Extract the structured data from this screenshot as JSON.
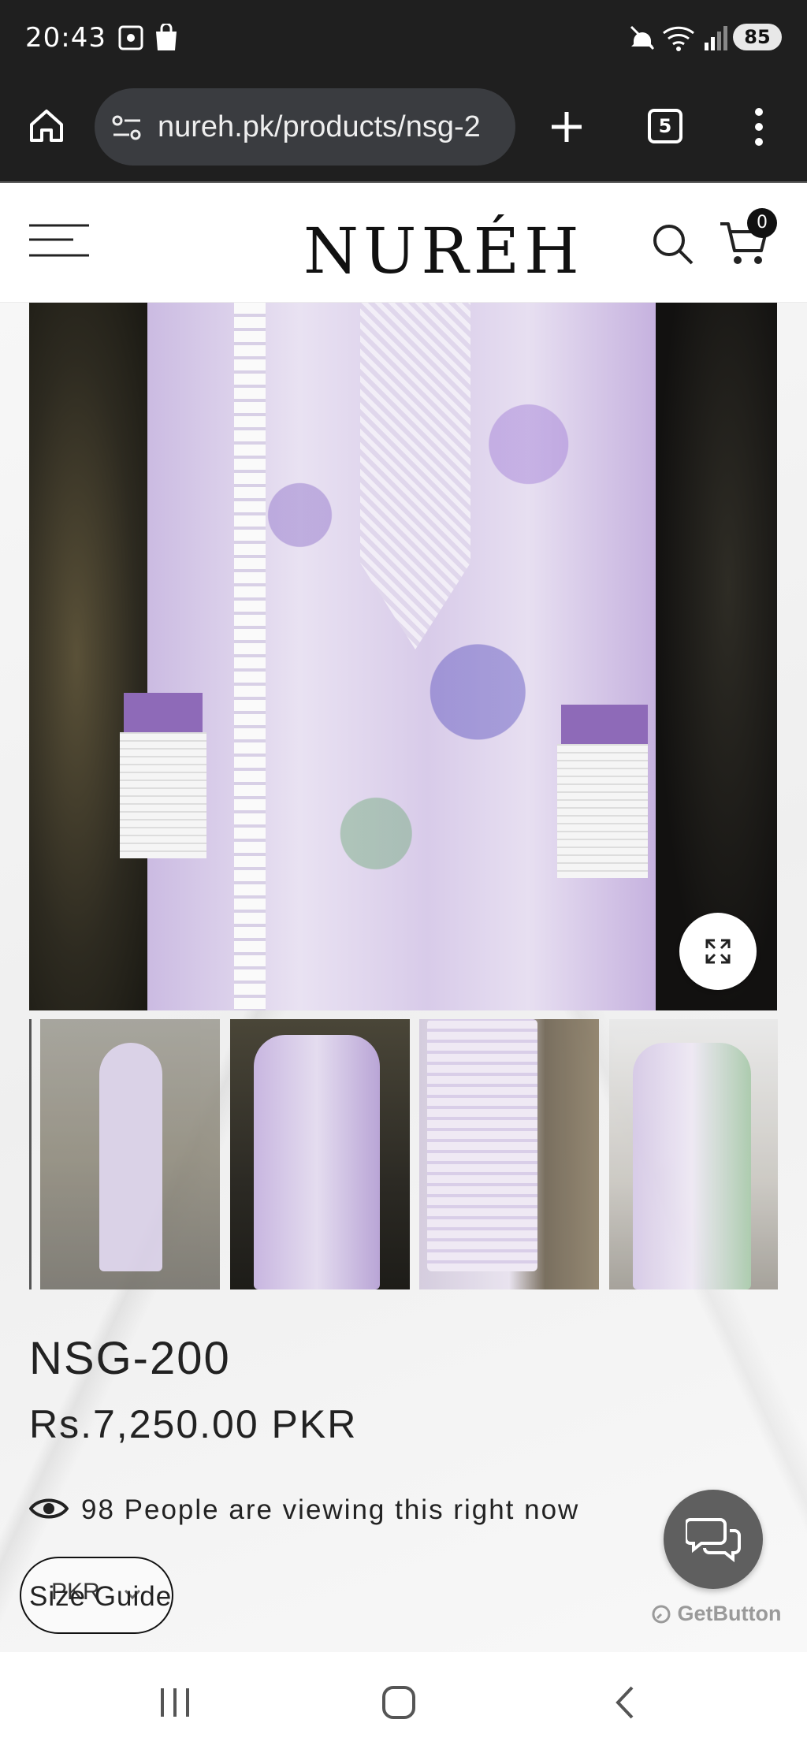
{
  "status_bar": {
    "time": "20:43",
    "battery": "85"
  },
  "browser": {
    "url": "nureh.pk/products/nsg-2",
    "tab_count": "5"
  },
  "site": {
    "logo": "NURÉH",
    "cart_count": "0"
  },
  "product": {
    "name": "NSG-200",
    "price": "Rs.7,250.00 PKR",
    "viewers": "98 People are viewing this right now",
    "size_guide": "Size Guide",
    "currency": "PKR"
  },
  "widget": {
    "brand": "GetButton"
  }
}
